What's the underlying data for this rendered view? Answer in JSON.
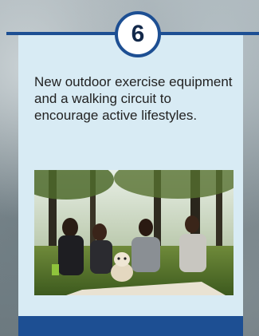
{
  "card": {
    "number": "6",
    "description": "New outdoor exercise equipment and a walking circuit to encourage active lifestyles."
  },
  "photo": {
    "subject": "park-picnic-photo"
  },
  "colors": {
    "accent": "#1d4f93",
    "card_background": "#d8ebf4",
    "text": "#222222"
  }
}
